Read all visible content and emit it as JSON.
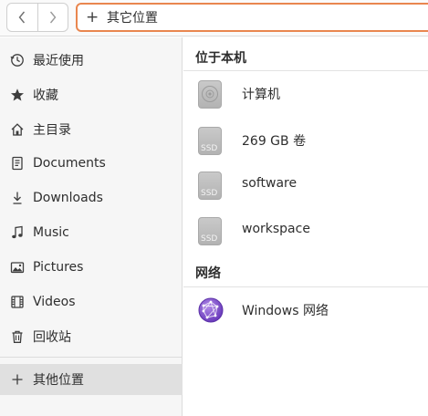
{
  "header": {
    "back_icon": "chevron-left-icon",
    "forward_icon": "chevron-right-icon",
    "location_icon": "plus-icon",
    "location_text": "其它位置"
  },
  "sidebar": {
    "items": [
      {
        "label": "最近使用",
        "icon": "clock-icon"
      },
      {
        "label": "收藏",
        "icon": "star-icon"
      },
      {
        "label": "主目录",
        "icon": "home-icon"
      },
      {
        "label": "Documents",
        "icon": "document-icon"
      },
      {
        "label": "Downloads",
        "icon": "download-icon"
      },
      {
        "label": "Music",
        "icon": "music-note-icon"
      },
      {
        "label": "Pictures",
        "icon": "picture-icon"
      },
      {
        "label": "Videos",
        "icon": "film-icon"
      },
      {
        "label": "回收站",
        "icon": "trash-icon"
      }
    ],
    "other_locations": {
      "label": "其他位置",
      "icon": "plus-icon"
    }
  },
  "main": {
    "on_this_computer": {
      "title": "位于本机",
      "items": [
        {
          "label": "计算机",
          "icon": "disc-drive-icon"
        },
        {
          "label": "269 GB 卷",
          "icon": "ssd-drive-icon",
          "badge": "SSD"
        },
        {
          "label": "software",
          "icon": "ssd-drive-icon",
          "badge": "SSD"
        },
        {
          "label": "workspace",
          "icon": "ssd-drive-icon",
          "badge": "SSD"
        }
      ]
    },
    "network": {
      "title": "网络",
      "items": [
        {
          "label": "Windows 网络",
          "icon": "network-globe-icon"
        }
      ]
    }
  },
  "colors": {
    "accent": "#e9864f",
    "sidebar_bg": "#f6f6f6",
    "selected_bg": "#e0e0e0",
    "globe": "#7b4fc9"
  }
}
